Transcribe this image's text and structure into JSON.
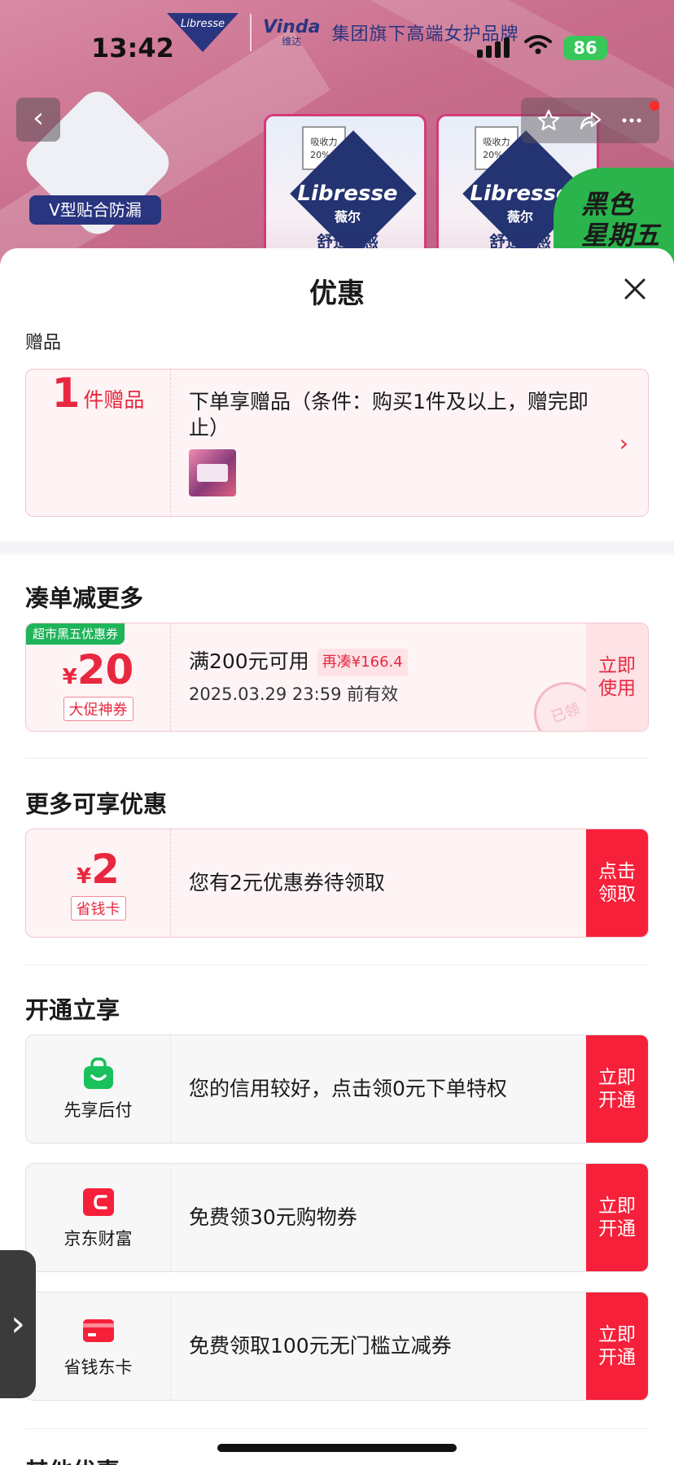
{
  "status_bar": {
    "time": "13:42",
    "battery": "86"
  },
  "banner": {
    "brand_libresse": "Libresse",
    "brand_vinda": "Vinda",
    "brand_vinda_cn": "维达",
    "slogan": "集团旗下高端女护品牌",
    "v_label": "V型贴合防漏",
    "pack_tag": "吸收力 20%↑",
    "pack_brand": "Libresse",
    "pack_brand_cn": "薇尔",
    "pack_text": "舒适V感",
    "black_friday_line1": "黑色",
    "black_friday_line2": "星期五"
  },
  "sheet": {
    "title": "优惠",
    "gift": {
      "label": "赠品",
      "count": "1",
      "unit": "件赠品",
      "desc": "下单享赠品（条件：购买1件及以上，赠完即止）"
    },
    "more_deals": {
      "title": "凑单减更多",
      "badge": "超市黑五优惠券",
      "currency": "¥",
      "amount": "20",
      "tag": "大促神券",
      "condition": "满200元可用",
      "pill": "再凑¥166.4",
      "expiry": "2025.03.29 23:59 前有效",
      "stamp": "已领",
      "action": "立即使用"
    },
    "more_offers": {
      "title": "更多可享优惠",
      "currency": "¥",
      "amount": "2",
      "tag": "省钱卡",
      "desc": "您有2元优惠券待领取",
      "action": "点击领取"
    },
    "activate": {
      "title": "开通立享",
      "items": [
        {
          "icon": "shopping-bag-icon",
          "name": "先享后付",
          "desc": "您的信用较好，点击领0元下单特权",
          "action": "立即开通"
        },
        {
          "icon": "wallet-icon",
          "name": "京东财富",
          "desc": "免费领30元购物券",
          "action": "立即开通"
        },
        {
          "icon": "card-icon",
          "name": "省钱东卡",
          "desc": "免费领取100元无门槛立减券",
          "action": "立即开通"
        }
      ]
    },
    "other": {
      "title": "其他优惠"
    }
  },
  "colors": {
    "accent": "#f6203a",
    "price": "#e8283f",
    "green": "#1fb45a"
  }
}
